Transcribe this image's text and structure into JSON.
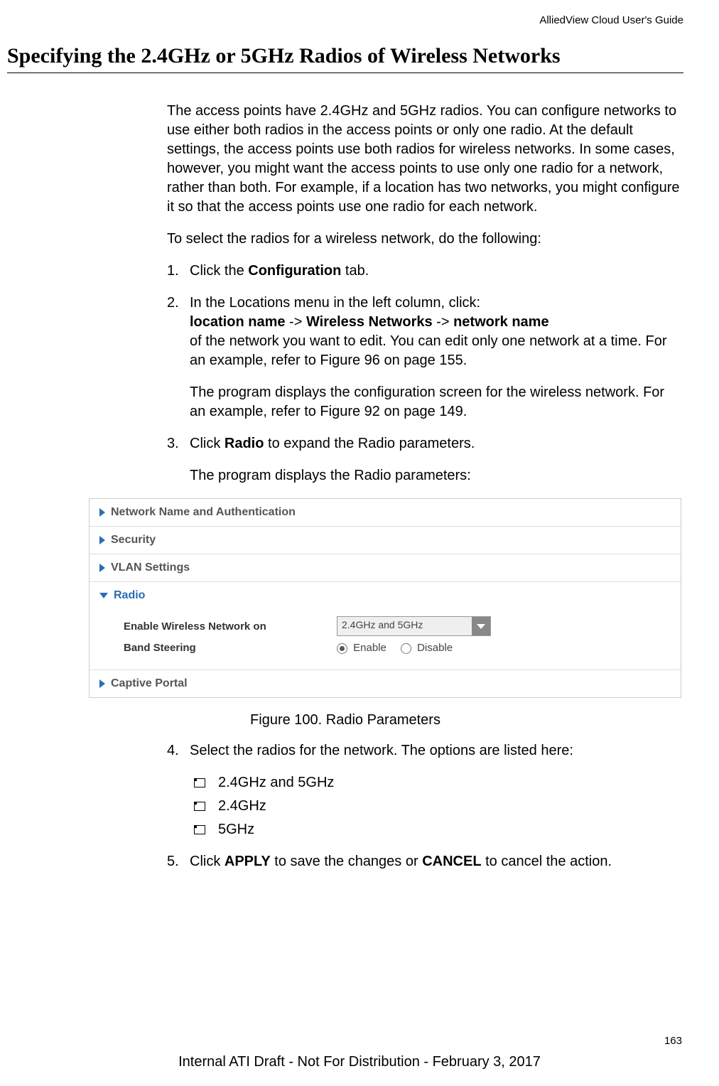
{
  "header": {
    "doc_title": "AlliedView Cloud User's Guide"
  },
  "section": {
    "title": "Specifying the 2.4GHz or 5GHz Radios of Wireless Networks"
  },
  "intro": {
    "p1": "The access points have 2.4GHz and 5GHz radios. You can configure networks to use either both radios in the access points or only one radio. At the default settings, the access points use both radios for wireless networks. In some cases, however, you might want the access points to use only one radio for a network, rather than both. For example, if a location has two networks, you might configure it so that the access points use one radio for each network.",
    "p2": "To select the radios for a wireless network, do the following:"
  },
  "steps": {
    "s1": {
      "num": "1.",
      "pre": "Click the ",
      "bold": "Configuration",
      "post": " tab."
    },
    "s2": {
      "num": "2.",
      "line1": "In the Locations menu in the left column, click:",
      "b1": "location name",
      "a1": " -> ",
      "b2": "Wireless Networks",
      "a2": " -> ",
      "b3": "network name",
      "line2": "of the network you want to edit. You can edit only one network at a time. For an example, refer to Figure 96 on page 155.",
      "sub": "The program displays the configuration screen for the wireless network. For an example, refer to Figure 92 on page 149."
    },
    "s3": {
      "num": "3.",
      "pre": "Click ",
      "bold": "Radio",
      "post": " to expand the Radio parameters.",
      "sub": "The program displays the Radio parameters:"
    },
    "s4": {
      "num": "4.",
      "text": "Select the radios for the network. The options are listed here:"
    },
    "s5": {
      "num": "5.",
      "pre": "Click ",
      "b1": "APPLY",
      "mid": " to save the changes or ",
      "b2": "CANCEL",
      "post": " to cancel the action."
    }
  },
  "options": {
    "o1": "2.4GHz and 5GHz",
    "o2": "2.4GHz",
    "o3": "5GHz"
  },
  "ui": {
    "rows": {
      "netauth": "Network Name and Authentication",
      "security": "Security",
      "vlan": "VLAN Settings",
      "radio": "Radio",
      "captive": "Captive Portal"
    },
    "radio": {
      "enable_label": "Enable Wireless Network on",
      "band_label": "Band Steering",
      "select_value": "2.4GHz and 5GHz",
      "opt_enable": "Enable",
      "opt_disable": "Disable"
    }
  },
  "figure": {
    "caption": "Figure 100. Radio Parameters"
  },
  "footer": {
    "page_num": "163",
    "draft": "Internal ATI Draft - Not For Distribution - February 3, 2017"
  }
}
